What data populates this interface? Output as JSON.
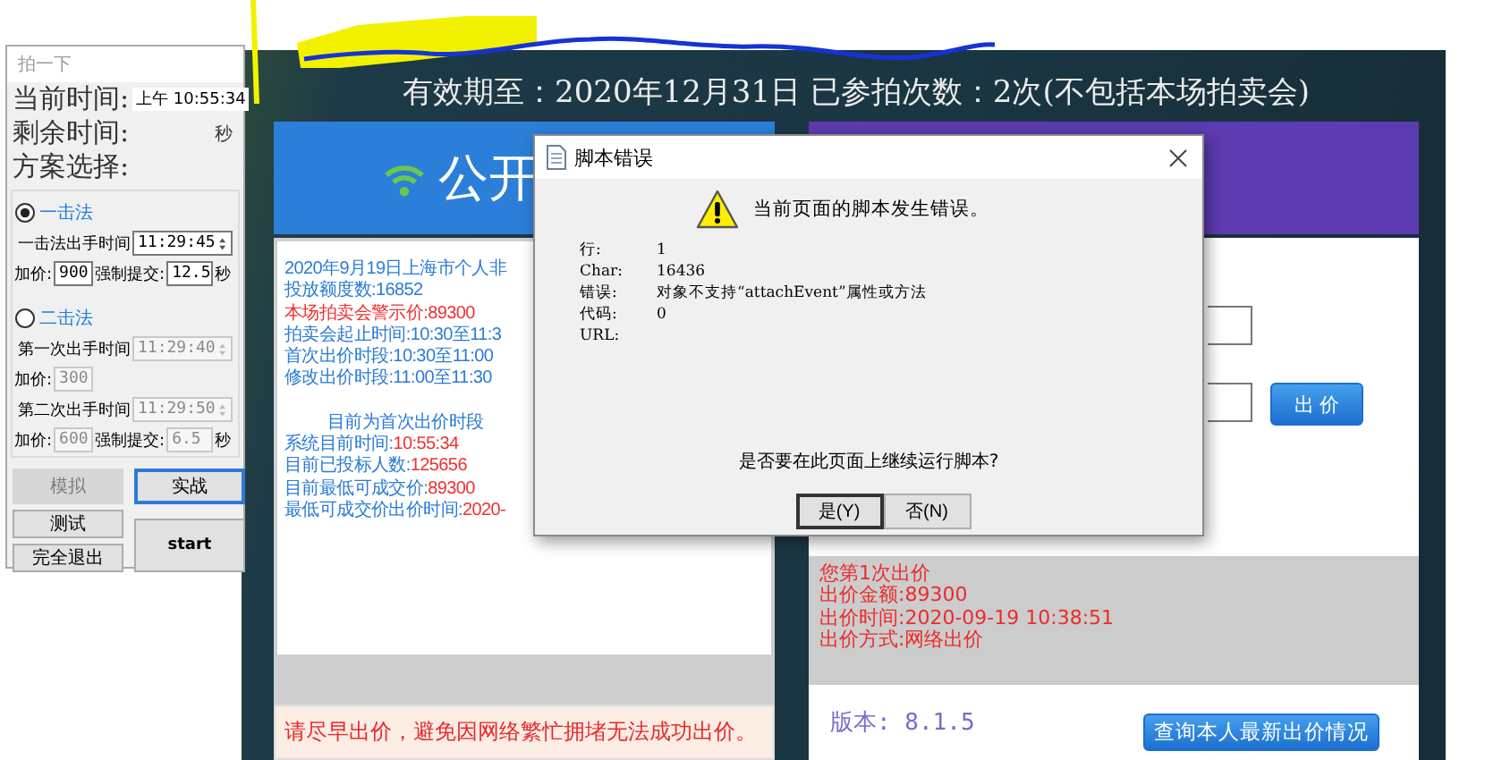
{
  "tool_window": {
    "title": "拍一下",
    "current_time_label": "当前时间:",
    "current_time": "上午 10:55:34",
    "remaining_label": "剩余时间:",
    "remaining_unit": "秒",
    "plan_label": "方案选择:",
    "plans": [
      {
        "label": "一击法",
        "selected": true,
        "rows": [
          {
            "kind": "time",
            "label": "一击法出手时间",
            "value": "11:29:45",
            "disabled": false
          },
          {
            "kind": "bid",
            "label": "加价:",
            "value": "900",
            "disabled": false,
            "limit_label": "强制提交:",
            "limit_value": "12.5",
            "unit": "秒"
          }
        ]
      },
      {
        "label": "二击法",
        "selected": false,
        "rows": [
          {
            "kind": "time",
            "label": "第一次出手时间",
            "value": "11:29:40",
            "disabled": true
          },
          {
            "kind": "bid",
            "label": "加价:",
            "value": "300",
            "disabled": true
          },
          {
            "kind": "time",
            "label": "第二次出手时间",
            "value": "11:29:50",
            "disabled": true
          },
          {
            "kind": "bid",
            "label": "加价:",
            "value": "600",
            "disabled": true,
            "limit_label": "强制提交:",
            "limit_value": "6.5",
            "unit": "秒"
          }
        ]
      }
    ],
    "buttons": [
      {
        "label": "模拟",
        "disabled": true,
        "focused": false
      },
      {
        "label": "实战",
        "disabled": false,
        "focused": true
      },
      {
        "label": "测试",
        "disabled": false,
        "focused": false
      },
      {
        "label": "start",
        "disabled": false,
        "focused": false
      },
      {
        "label": "完全退出",
        "disabled": false,
        "focused": false
      }
    ]
  },
  "page": {
    "validity": "有效期至：2020年12月31日 已参拍次数：2次(不包括本场拍卖会)",
    "left_panel": {
      "title": "公开",
      "lines": [
        {
          "kind": "plain",
          "text": "2020年9月19日上海市个人非"
        },
        {
          "kind": "plain",
          "text": "投放额度数:16852"
        },
        {
          "kind": "alert",
          "text": "本场拍卖会警示价:89300"
        },
        {
          "kind": "plain",
          "text": "拍卖会起止时间:10:30至11:3"
        },
        {
          "kind": "plain",
          "text": "首次出价时段:10:30至11:00"
        },
        {
          "kind": "plain",
          "text": "修改出价时段:11:00至11:30"
        },
        {
          "kind": "heading",
          "text": "目前为首次出价时段"
        },
        {
          "kind": "pair",
          "label": "系统目前时间:",
          "value": "10:55:34"
        },
        {
          "kind": "pair",
          "label": "目前已投标人数:",
          "value": "125656"
        },
        {
          "kind": "pair",
          "label": "目前最低可成交价:",
          "value": "89300"
        },
        {
          "kind": "pair",
          "label": "最低可成交价出价时间:",
          "value": "2020-"
        }
      ],
      "notice": "请尽早出价，避免因网络繁忙拥堵无法成功出价。"
    },
    "right_panel": {
      "bid_button": "出 价",
      "bid_record": [
        "您第1次出价",
        "出价金额:89300",
        "出价时间:2020-09-19 10:38:51",
        "出价方式:网络出价"
      ],
      "version": "版本: 8.1.5",
      "query_button": "查询本人最新出价情况"
    }
  },
  "dialog": {
    "title": "脚本错误",
    "message": "当前页面的脚本发生错误。",
    "details": [
      {
        "label": "行:",
        "value": "1"
      },
      {
        "label": "Char:",
        "value": "16436"
      },
      {
        "label": "错误:",
        "value": "对象不支持“attachEvent”属性或方法"
      },
      {
        "label": "代码:",
        "value": "0"
      },
      {
        "label": "URL:"
      }
    ],
    "question": "是否要在此页面上继续运行脚本?",
    "buttons": [
      {
        "label": "是(Y)",
        "default": true
      },
      {
        "label": "否(N)",
        "default": false
      }
    ]
  }
}
